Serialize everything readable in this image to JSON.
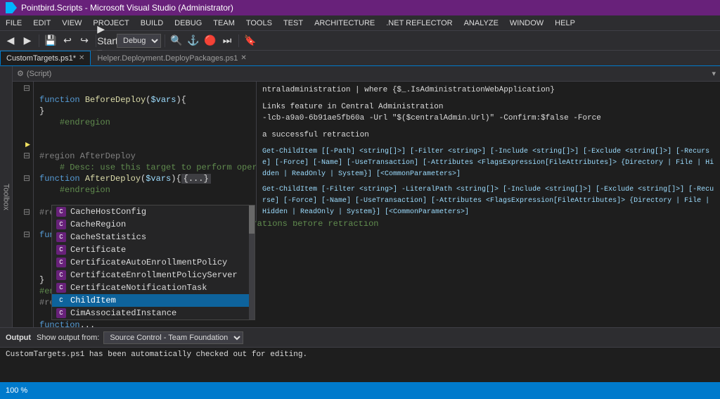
{
  "titleBar": {
    "title": "Pointbird.Scripts - Microsoft Visual Studio (Administrator)"
  },
  "menuBar": {
    "items": [
      "FILE",
      "EDIT",
      "VIEW",
      "PROJECT",
      "BUILD",
      "DEBUG",
      "TEAM",
      "TOOLS",
      "TEST",
      "ARCHITECTURE",
      ".NET REFLECTOR",
      "ANALYZE",
      "WINDOW",
      "HELP"
    ]
  },
  "tabs": [
    {
      "label": "CustomTargets.ps1*",
      "active": true,
      "modified": true
    },
    {
      "label": "Helper.Deployment.DeployPackages.ps1",
      "active": false,
      "modified": false
    }
  ],
  "breadcrumb": {
    "scope": "(Script)"
  },
  "debugDropdown": "Debug",
  "codeLines": [
    {
      "num": "",
      "text": ""
    },
    {
      "num": "",
      "text": "function BeforeDeploy($vars){"
    },
    {
      "num": "",
      "text": "}"
    },
    {
      "num": "",
      "text": "    #endregion"
    },
    {
      "num": "",
      "text": ""
    },
    {
      "num": "",
      "text": ""
    },
    {
      "num": "",
      "text": "#region AfterDeploy"
    },
    {
      "num": "",
      "text": "    # Desc: use this target to perform operations after a successful deployment"
    },
    {
      "num": "",
      "text": "function AfterDeploy($vars){...}"
    },
    {
      "num": "",
      "text": "    #endregion"
    },
    {
      "num": "",
      "text": ""
    },
    {
      "num": "",
      "text": "#region BeforeRetract"
    },
    {
      "num": "",
      "text": "    # Desc: use this target to perform operations before retraction"
    },
    {
      "num": "",
      "text": "function BeforeRetract($vars){"
    }
  ],
  "autocomplete": {
    "items": [
      "CacheHostConfig",
      "CacheRegion",
      "CacheStatistics",
      "Certificate",
      "CertificateAutoEnrollmentPolicy",
      "CertificateEnrollmentPolicyServer",
      "CertificateNotificationTask",
      "ChildItem",
      "CimAssociatedInstance"
    ],
    "selectedIndex": 7
  },
  "tooltipLines": [
    "ntraladministration | where {$_.IsAdministrationWebApplication}",
    "",
    "    Links feature in Central Administration",
    "    -lcb-a9a0-6b91ae5fb60a -Url \"$($centralAdmin.Url)\" -Confirm:$false -Force",
    "",
    "a successful retraction",
    "",
    "Get-ChildItem [[-Path] <string[]>] [-Filter <string>] [-Include <string[]>] [-Exclude <string[]>] [-Recurse] [-Force] [-Name] [-UseTransaction] [-Attributes <FlagsExpression[FileAttributes]> {Directory | File | Hidden | ReadOnly | System}] [<CommonParameters>]",
    "",
    "Get-ChildItem [-Filter <string>] -LiteralPath <string[]> [-Include <string[]>] [-Exclude <string[]>] [-Recurse] [-Force] [-Name] [-UseTransaction] [-Attributes <FlagsExpression[FileAttributes]> {Directory | File | Hidden | ReadOnly | System}] [<CommonParameters>]"
  ],
  "outputBar": {
    "label": "Output",
    "showOutputFrom": "Show output from:",
    "sourceOption": "Source Control - Team Foundation"
  },
  "outputContent": "CustomTargets.ps1 has been automatically checked out for editing.",
  "statusBar": {
    "zoom": "100 %",
    "message": ""
  },
  "toolbox": {
    "label": "Toolbox"
  }
}
